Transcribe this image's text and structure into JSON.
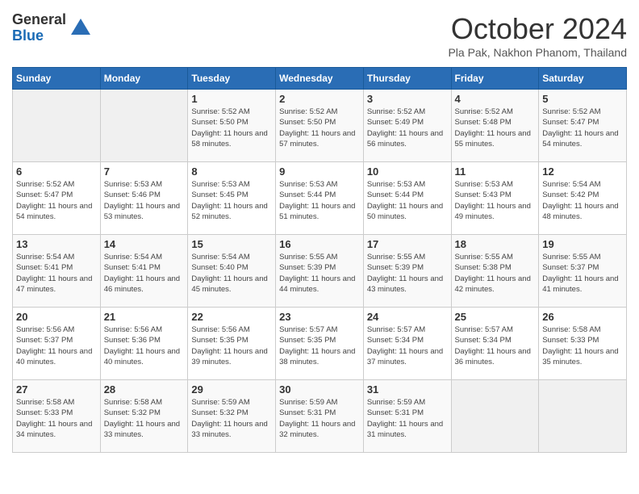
{
  "logo": {
    "general": "General",
    "blue": "Blue"
  },
  "title": "October 2024",
  "location": "Pla Pak, Nakhon Phanom, Thailand",
  "days_of_week": [
    "Sunday",
    "Monday",
    "Tuesday",
    "Wednesday",
    "Thursday",
    "Friday",
    "Saturday"
  ],
  "weeks": [
    [
      {
        "day": "",
        "sunrise": "",
        "sunset": "",
        "daylight": ""
      },
      {
        "day": "",
        "sunrise": "",
        "sunset": "",
        "daylight": ""
      },
      {
        "day": "1",
        "sunrise": "Sunrise: 5:52 AM",
        "sunset": "Sunset: 5:50 PM",
        "daylight": "Daylight: 11 hours and 58 minutes."
      },
      {
        "day": "2",
        "sunrise": "Sunrise: 5:52 AM",
        "sunset": "Sunset: 5:50 PM",
        "daylight": "Daylight: 11 hours and 57 minutes."
      },
      {
        "day": "3",
        "sunrise": "Sunrise: 5:52 AM",
        "sunset": "Sunset: 5:49 PM",
        "daylight": "Daylight: 11 hours and 56 minutes."
      },
      {
        "day": "4",
        "sunrise": "Sunrise: 5:52 AM",
        "sunset": "Sunset: 5:48 PM",
        "daylight": "Daylight: 11 hours and 55 minutes."
      },
      {
        "day": "5",
        "sunrise": "Sunrise: 5:52 AM",
        "sunset": "Sunset: 5:47 PM",
        "daylight": "Daylight: 11 hours and 54 minutes."
      }
    ],
    [
      {
        "day": "6",
        "sunrise": "Sunrise: 5:52 AM",
        "sunset": "Sunset: 5:47 PM",
        "daylight": "Daylight: 11 hours and 54 minutes."
      },
      {
        "day": "7",
        "sunrise": "Sunrise: 5:53 AM",
        "sunset": "Sunset: 5:46 PM",
        "daylight": "Daylight: 11 hours and 53 minutes."
      },
      {
        "day": "8",
        "sunrise": "Sunrise: 5:53 AM",
        "sunset": "Sunset: 5:45 PM",
        "daylight": "Daylight: 11 hours and 52 minutes."
      },
      {
        "day": "9",
        "sunrise": "Sunrise: 5:53 AM",
        "sunset": "Sunset: 5:44 PM",
        "daylight": "Daylight: 11 hours and 51 minutes."
      },
      {
        "day": "10",
        "sunrise": "Sunrise: 5:53 AM",
        "sunset": "Sunset: 5:44 PM",
        "daylight": "Daylight: 11 hours and 50 minutes."
      },
      {
        "day": "11",
        "sunrise": "Sunrise: 5:53 AM",
        "sunset": "Sunset: 5:43 PM",
        "daylight": "Daylight: 11 hours and 49 minutes."
      },
      {
        "day": "12",
        "sunrise": "Sunrise: 5:54 AM",
        "sunset": "Sunset: 5:42 PM",
        "daylight": "Daylight: 11 hours and 48 minutes."
      }
    ],
    [
      {
        "day": "13",
        "sunrise": "Sunrise: 5:54 AM",
        "sunset": "Sunset: 5:41 PM",
        "daylight": "Daylight: 11 hours and 47 minutes."
      },
      {
        "day": "14",
        "sunrise": "Sunrise: 5:54 AM",
        "sunset": "Sunset: 5:41 PM",
        "daylight": "Daylight: 11 hours and 46 minutes."
      },
      {
        "day": "15",
        "sunrise": "Sunrise: 5:54 AM",
        "sunset": "Sunset: 5:40 PM",
        "daylight": "Daylight: 11 hours and 45 minutes."
      },
      {
        "day": "16",
        "sunrise": "Sunrise: 5:55 AM",
        "sunset": "Sunset: 5:39 PM",
        "daylight": "Daylight: 11 hours and 44 minutes."
      },
      {
        "day": "17",
        "sunrise": "Sunrise: 5:55 AM",
        "sunset": "Sunset: 5:39 PM",
        "daylight": "Daylight: 11 hours and 43 minutes."
      },
      {
        "day": "18",
        "sunrise": "Sunrise: 5:55 AM",
        "sunset": "Sunset: 5:38 PM",
        "daylight": "Daylight: 11 hours and 42 minutes."
      },
      {
        "day": "19",
        "sunrise": "Sunrise: 5:55 AM",
        "sunset": "Sunset: 5:37 PM",
        "daylight": "Daylight: 11 hours and 41 minutes."
      }
    ],
    [
      {
        "day": "20",
        "sunrise": "Sunrise: 5:56 AM",
        "sunset": "Sunset: 5:37 PM",
        "daylight": "Daylight: 11 hours and 40 minutes."
      },
      {
        "day": "21",
        "sunrise": "Sunrise: 5:56 AM",
        "sunset": "Sunset: 5:36 PM",
        "daylight": "Daylight: 11 hours and 40 minutes."
      },
      {
        "day": "22",
        "sunrise": "Sunrise: 5:56 AM",
        "sunset": "Sunset: 5:35 PM",
        "daylight": "Daylight: 11 hours and 39 minutes."
      },
      {
        "day": "23",
        "sunrise": "Sunrise: 5:57 AM",
        "sunset": "Sunset: 5:35 PM",
        "daylight": "Daylight: 11 hours and 38 minutes."
      },
      {
        "day": "24",
        "sunrise": "Sunrise: 5:57 AM",
        "sunset": "Sunset: 5:34 PM",
        "daylight": "Daylight: 11 hours and 37 minutes."
      },
      {
        "day": "25",
        "sunrise": "Sunrise: 5:57 AM",
        "sunset": "Sunset: 5:34 PM",
        "daylight": "Daylight: 11 hours and 36 minutes."
      },
      {
        "day": "26",
        "sunrise": "Sunrise: 5:58 AM",
        "sunset": "Sunset: 5:33 PM",
        "daylight": "Daylight: 11 hours and 35 minutes."
      }
    ],
    [
      {
        "day": "27",
        "sunrise": "Sunrise: 5:58 AM",
        "sunset": "Sunset: 5:33 PM",
        "daylight": "Daylight: 11 hours and 34 minutes."
      },
      {
        "day": "28",
        "sunrise": "Sunrise: 5:58 AM",
        "sunset": "Sunset: 5:32 PM",
        "daylight": "Daylight: 11 hours and 33 minutes."
      },
      {
        "day": "29",
        "sunrise": "Sunrise: 5:59 AM",
        "sunset": "Sunset: 5:32 PM",
        "daylight": "Daylight: 11 hours and 33 minutes."
      },
      {
        "day": "30",
        "sunrise": "Sunrise: 5:59 AM",
        "sunset": "Sunset: 5:31 PM",
        "daylight": "Daylight: 11 hours and 32 minutes."
      },
      {
        "day": "31",
        "sunrise": "Sunrise: 5:59 AM",
        "sunset": "Sunset: 5:31 PM",
        "daylight": "Daylight: 11 hours and 31 minutes."
      },
      {
        "day": "",
        "sunrise": "",
        "sunset": "",
        "daylight": ""
      },
      {
        "day": "",
        "sunrise": "",
        "sunset": "",
        "daylight": ""
      }
    ]
  ]
}
